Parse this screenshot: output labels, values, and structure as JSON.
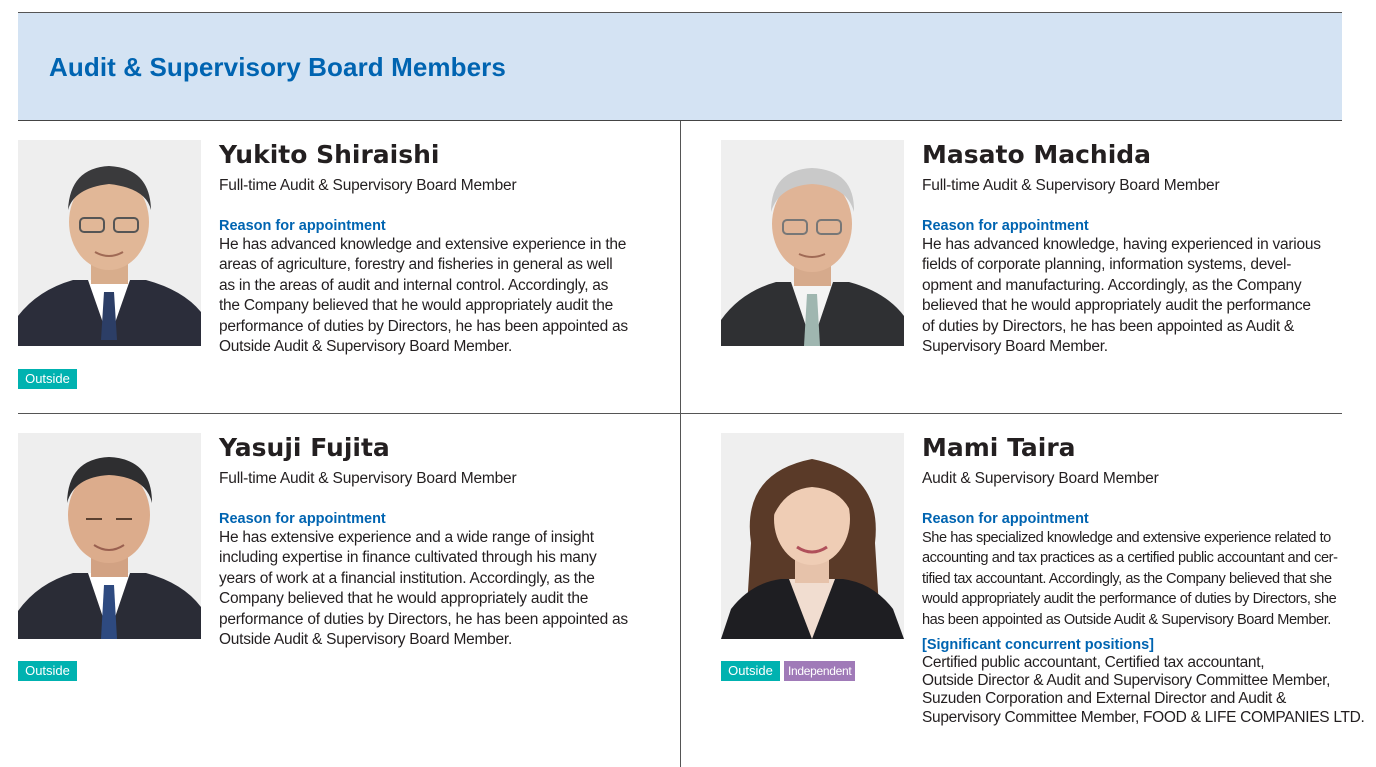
{
  "section": {
    "title": "Audit & Supervisory Board Members"
  },
  "reason_label": "Reason for appointment",
  "colors": {
    "accent_blue": "#0064b1",
    "header_bg": "#d4e3f3",
    "outside_badge": "#00b2b0",
    "independent_badge": "#a07ab8"
  },
  "members": [
    {
      "name": "Yukito Shiraishi",
      "position": "Full-time Audit & Supervisory Board Member",
      "reason_lines": [
        "He has advanced knowledge and extensive experience in the",
        "areas of agriculture, forestry and fisheries in general as well",
        "as in the areas of audit and internal control. Accordingly, as",
        "the Company believed that he would appropriately audit the",
        "performance of duties by Directors, he has been appointed as",
        "Outside Audit & Supervisory Board Member."
      ],
      "badges": [
        "Outside"
      ]
    },
    {
      "name": "Masato Machida",
      "position": "Full-time Audit & Supervisory Board Member",
      "reason_lines": [
        "He has advanced knowledge, having experienced in various",
        "fields of corporate planning, information systems, devel-",
        "opment and manufacturing. Accordingly, as the Company",
        "believed that he would appropriately audit the performance",
        "of duties by Directors, he has been appointed as Audit &",
        "Supervisory Board Member."
      ],
      "badges": []
    },
    {
      "name": "Yasuji Fujita",
      "position": "Full-time Audit & Supervisory Board Member",
      "reason_lines": [
        "He has extensive experience and a wide range of insight",
        "including expertise in finance cultivated through his many",
        "years of work at a financial institution. Accordingly, as the",
        "Company believed that he would appropriately audit the",
        "performance of duties by Directors, he has been appointed as",
        "Outside Audit & Supervisory Board Member."
      ],
      "badges": [
        "Outside"
      ]
    },
    {
      "name": "Mami Taira",
      "position": "Audit & Supervisory Board Member",
      "reason_lines": [
        "She has specialized knowledge and extensive experience related to",
        "accounting and tax practices as a certified public accountant and cer-",
        "tified tax accountant. Accordingly, as the Company believed that she",
        "would appropriately audit the performance of duties by Directors, she",
        "has been appointed as Outside Audit & Supervisory Board Member."
      ],
      "badges": [
        "Outside",
        "Independent"
      ],
      "concurrent_label": "[Significant concurrent positions]",
      "concurrent_lines": [
        "Certified public accountant, Certified tax accountant,",
        "Outside Director & Audit and Supervisory Committee Member,",
        "Suzuden Corporation and External Director and Audit &",
        "Supervisory Committee Member, FOOD & LIFE COMPANIES LTD."
      ]
    }
  ]
}
